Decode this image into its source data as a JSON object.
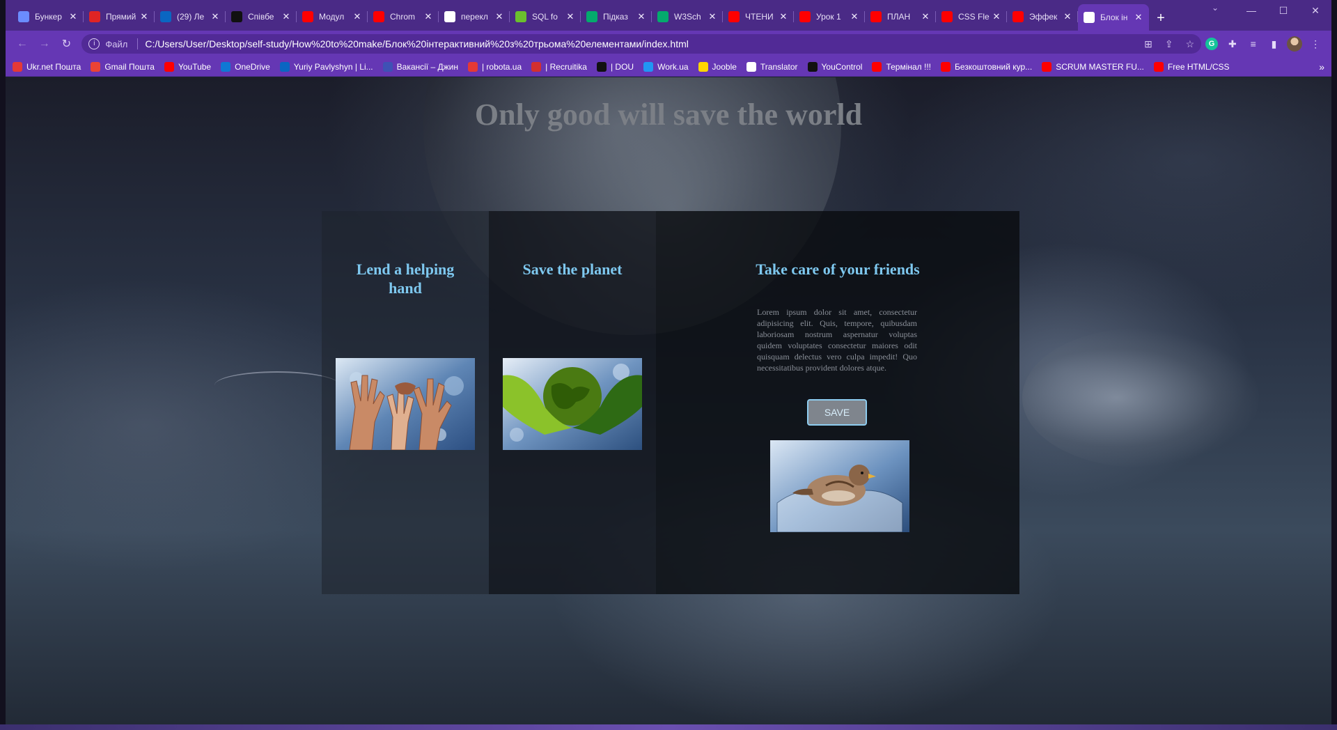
{
  "browser": {
    "tabs": [
      {
        "title": "Бункер",
        "icon": "bunker-favicon",
        "color": "#6b8cff"
      },
      {
        "title": "Прямий",
        "icon": "24-channel-favicon",
        "color": "#e02424"
      },
      {
        "title": "(29) Ле",
        "icon": "linkedin-favicon",
        "color": "#0a66c2"
      },
      {
        "title": "Співбе",
        "icon": "dou-favicon",
        "color": "#111111"
      },
      {
        "title": "Модул",
        "icon": "youtube-favicon",
        "color": "#ff0000"
      },
      {
        "title": "Chrom",
        "icon": "youtube-favicon",
        "color": "#ff0000"
      },
      {
        "title": "перекл",
        "icon": "google-favicon",
        "color": "#ffffff"
      },
      {
        "title": "SQL fo",
        "icon": "metanit-favicon",
        "color": "#6bbf2e"
      },
      {
        "title": "Підказ",
        "icon": "w3-favicon",
        "color": "#04aa6d"
      },
      {
        "title": "W3Sch",
        "icon": "w3-favicon",
        "color": "#04aa6d"
      },
      {
        "title": "ЧТЕНИ",
        "icon": "youtube-favicon",
        "color": "#ff0000"
      },
      {
        "title": "Урок 1",
        "icon": "youtube-favicon",
        "color": "#ff0000"
      },
      {
        "title": "ПЛАН",
        "icon": "youtube-favicon",
        "color": "#ff0000"
      },
      {
        "title": "CSS Fle",
        "icon": "youtube-favicon",
        "color": "#ff0000"
      },
      {
        "title": "Эффек",
        "icon": "youtube-favicon",
        "color": "#ff0000"
      },
      {
        "title": "Блок ін",
        "icon": "globe-favicon",
        "color": "#ffffff"
      }
    ],
    "close_glyph": "✕",
    "new_tab_glyph": "+",
    "address": {
      "scheme_label": "Файл",
      "url": "C:/Users/User/Desktop/self-study/How%20to%20make/Блок%20інтерактивний%20з%20трьома%20елементами/index.html"
    },
    "bookmarks": [
      {
        "label": "Ukr.net Пошта",
        "icon": "ukrnet-icon",
        "color": "#e53935"
      },
      {
        "label": "Gmail Пошта",
        "icon": "gmail-icon",
        "color": "#ea4335"
      },
      {
        "label": "YouTube",
        "icon": "youtube-icon",
        "color": "#ff0000"
      },
      {
        "label": "OneDrive",
        "icon": "onedrive-icon",
        "color": "#0f78d4"
      },
      {
        "label": "Yuriy Pavlyshyn | Li...",
        "icon": "linkedin-icon",
        "color": "#0a66c2"
      },
      {
        "label": "Вакансії – Джин",
        "icon": "djinni-icon",
        "color": "#3f51b5"
      },
      {
        "label": "| robota.ua",
        "icon": "robota-icon",
        "color": "#e53935"
      },
      {
        "label": "| Recruitika",
        "icon": "recruitika-icon",
        "color": "#d32f2f"
      },
      {
        "label": "| DOU",
        "icon": "dou-icon",
        "color": "#111111"
      },
      {
        "label": "Work.ua",
        "icon": "workua-icon",
        "color": "#2196f3"
      },
      {
        "label": "Jooble",
        "icon": "jooble-icon",
        "color": "#ffd600"
      },
      {
        "label": "Translator",
        "icon": "google-icon",
        "color": "#ffffff"
      },
      {
        "label": "YouControl",
        "icon": "youcontrol-icon",
        "color": "#111111"
      },
      {
        "label": "Термінал !!!",
        "icon": "youtube-icon",
        "color": "#ff0000"
      },
      {
        "label": "Безкоштовний кур...",
        "icon": "youtube-icon",
        "color": "#ff0000"
      },
      {
        "label": "SCRUM MASTER FU...",
        "icon": "youtube-icon",
        "color": "#ff0000"
      },
      {
        "label": "Free HTML/CSS",
        "icon": "youtube-icon",
        "color": "#ff0000"
      }
    ],
    "bookmarks_more": "»"
  },
  "page": {
    "headline": "Only good will save the world",
    "cards": [
      {
        "title": "Lend a helping hand",
        "image": "helping-hands-image"
      },
      {
        "title": "Save the planet",
        "image": "green-globe-hands-image"
      },
      {
        "title": "Take care of your friends",
        "image": "sparrow-in-hands-image",
        "text": "Lorem ipsum dolor sit amet, consectetur adipisicing elit. Quis, tempore, quibusdam laboriosam nostrum aspernatur voluptas quidem voluptates consectetur maiores odit quisquam delectus vero culpa impedit! Quo necessitatibus provident dolores atque.",
        "button_label": "SAVE"
      }
    ]
  },
  "colors": {
    "browser_frame": "#4a2a86",
    "toolbar": "#6537b4",
    "card_title": "#7ec8ef",
    "headline": "#7b7f86",
    "button_border": "#8ecdf0"
  }
}
